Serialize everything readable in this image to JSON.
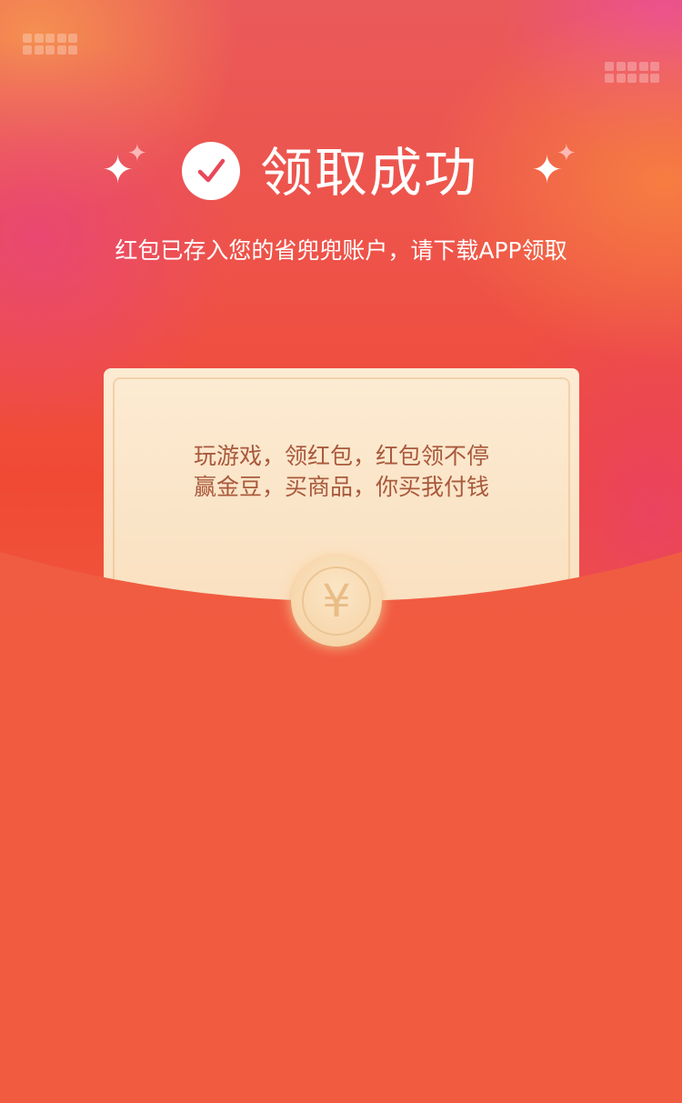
{
  "header": {
    "title": "领取成功",
    "subtitle": "红包已存入您的省兜兜账户，请下载APP领取"
  },
  "card": {
    "line1": "玩游戏，领红包，红包领不停",
    "line2": "赢金豆，买商品，你买我付钱"
  },
  "coin": {
    "symbol": "¥"
  },
  "decor": {
    "sparkle_char": "✦",
    "accent": "#f15b40",
    "check_color": "#e8485a"
  }
}
